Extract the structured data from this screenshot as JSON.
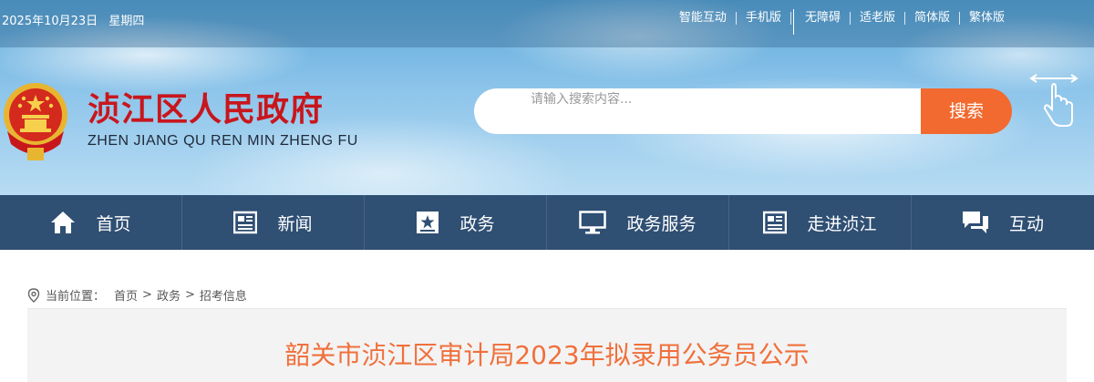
{
  "topbar": {
    "date": "2025年10月23日",
    "weekday": "星期四",
    "links": [
      "智能互动",
      "手机版",
      "无障碍",
      "适老版",
      "简体版",
      "繁体版"
    ]
  },
  "site": {
    "title": "浈江区人民政府",
    "pinyin": "ZHEN JIANG QU REN MIN ZHENG FU"
  },
  "search": {
    "placeholder": "请输入搜索内容...",
    "button": "搜索"
  },
  "nav": [
    {
      "label": "首页",
      "icon": "home-icon"
    },
    {
      "label": "新闻",
      "icon": "newspaper-icon"
    },
    {
      "label": "政务",
      "icon": "star-badge-icon"
    },
    {
      "label": "政务服务",
      "icon": "monitor-icon"
    },
    {
      "label": "走进浈江",
      "icon": "newspaper-icon"
    },
    {
      "label": "互动",
      "icon": "chat-icon"
    }
  ],
  "breadcrumb": {
    "label": "当前位置：",
    "items": [
      "首页",
      "政务",
      "招考信息"
    ]
  },
  "article": {
    "title": "韶关市浈江区审计局2023年拟录用公务员公示"
  },
  "colors": {
    "nav_bg": "#2f4f73",
    "search_button": "#f26a2f",
    "title_red": "#c8161d",
    "article_title": "#f0703c"
  }
}
